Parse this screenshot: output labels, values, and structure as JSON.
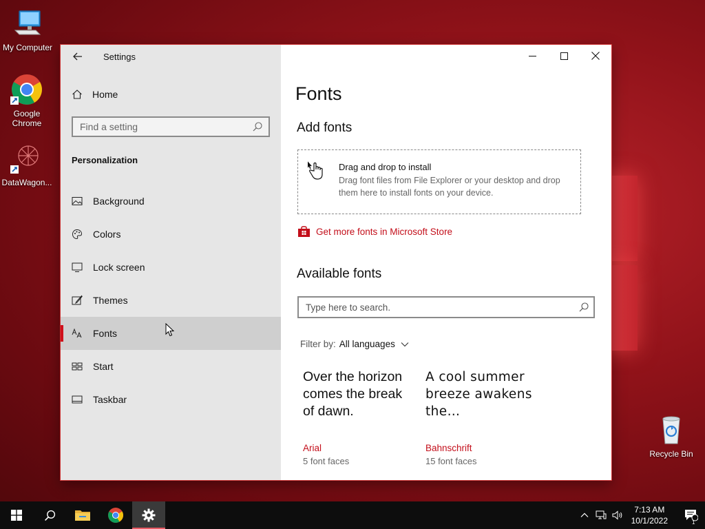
{
  "desktop": {
    "icons": [
      {
        "label": "My Computer"
      },
      {
        "label": "Google Chrome"
      },
      {
        "label": "DataWagon..."
      },
      {
        "label": "Recycle Bin"
      }
    ]
  },
  "window": {
    "app_title": "Settings",
    "sidebar": {
      "home_label": "Home",
      "search_placeholder": "Find a setting",
      "section_title": "Personalization",
      "items": [
        {
          "label": "Background",
          "icon": "picture-icon"
        },
        {
          "label": "Colors",
          "icon": "palette-icon"
        },
        {
          "label": "Lock screen",
          "icon": "monitor-icon"
        },
        {
          "label": "Themes",
          "icon": "brush-icon"
        },
        {
          "label": "Fonts",
          "icon": "font-icon",
          "active": true
        },
        {
          "label": "Start",
          "icon": "start-grid-icon"
        },
        {
          "label": "Taskbar",
          "icon": "taskbar-icon"
        }
      ]
    },
    "main": {
      "title": "Fonts",
      "add_fonts": {
        "heading": "Add fonts",
        "drop_title": "Drag and drop to install",
        "drop_description": "Drag font files from File Explorer or your desktop and drop them here to install fonts on your device."
      },
      "store_link": "Get more fonts in Microsoft Store",
      "available": {
        "heading": "Available fonts",
        "search_placeholder": "Type here to search.",
        "filter_label": "Filter by:",
        "filter_value": "All languages"
      },
      "fonts": [
        {
          "sample": "Over the horizon comes the break of dawn.",
          "name": "Arial",
          "faces": "5 font faces"
        },
        {
          "sample": "A cool summer breeze awakens the…",
          "name": "Bahnschrift",
          "faces": "15 font faces"
        }
      ]
    }
  },
  "taskbar": {
    "time": "7:13 AM",
    "date": "10/1/2022",
    "notification_count": "1"
  },
  "colors": {
    "accent": "#d0101b",
    "link": "#c30e1a"
  }
}
